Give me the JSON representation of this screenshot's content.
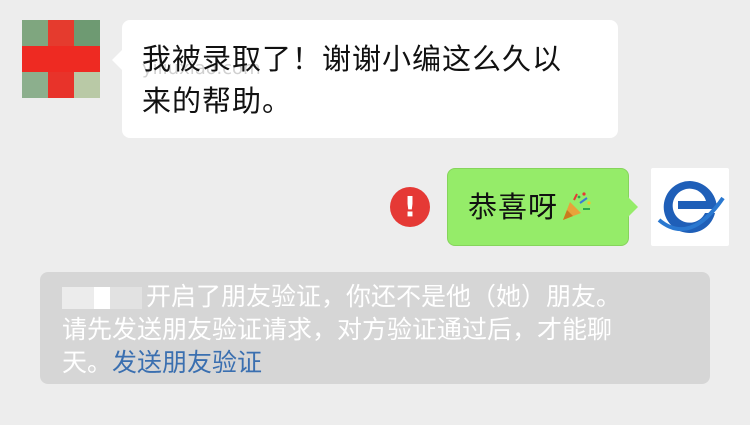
{
  "incoming_message": {
    "text_line1": "我被录取了！谢谢小编这么久以",
    "text_line2": "来的帮助。",
    "watermark": "yiliuxiao.com"
  },
  "outgoing_message": {
    "text": "恭喜呀",
    "emoji_icon": "party-popper-icon",
    "status_icon": "error-icon",
    "status_symbol": "!"
  },
  "system_notice": {
    "text_part1": "开启了朋友验证，你还不是他（她）朋友。",
    "text_part2": "请先发送朋友验证请求，对方验证通过后，才能聊",
    "text_part3": "天。",
    "link_label": "发送朋友验证"
  },
  "colors": {
    "background": "#ededed",
    "incoming_bubble": "#ffffff",
    "outgoing_bubble": "#95ec69",
    "error_badge": "#e53935",
    "notice_bg": "#d6d6d6",
    "link": "#3a6fb0"
  }
}
